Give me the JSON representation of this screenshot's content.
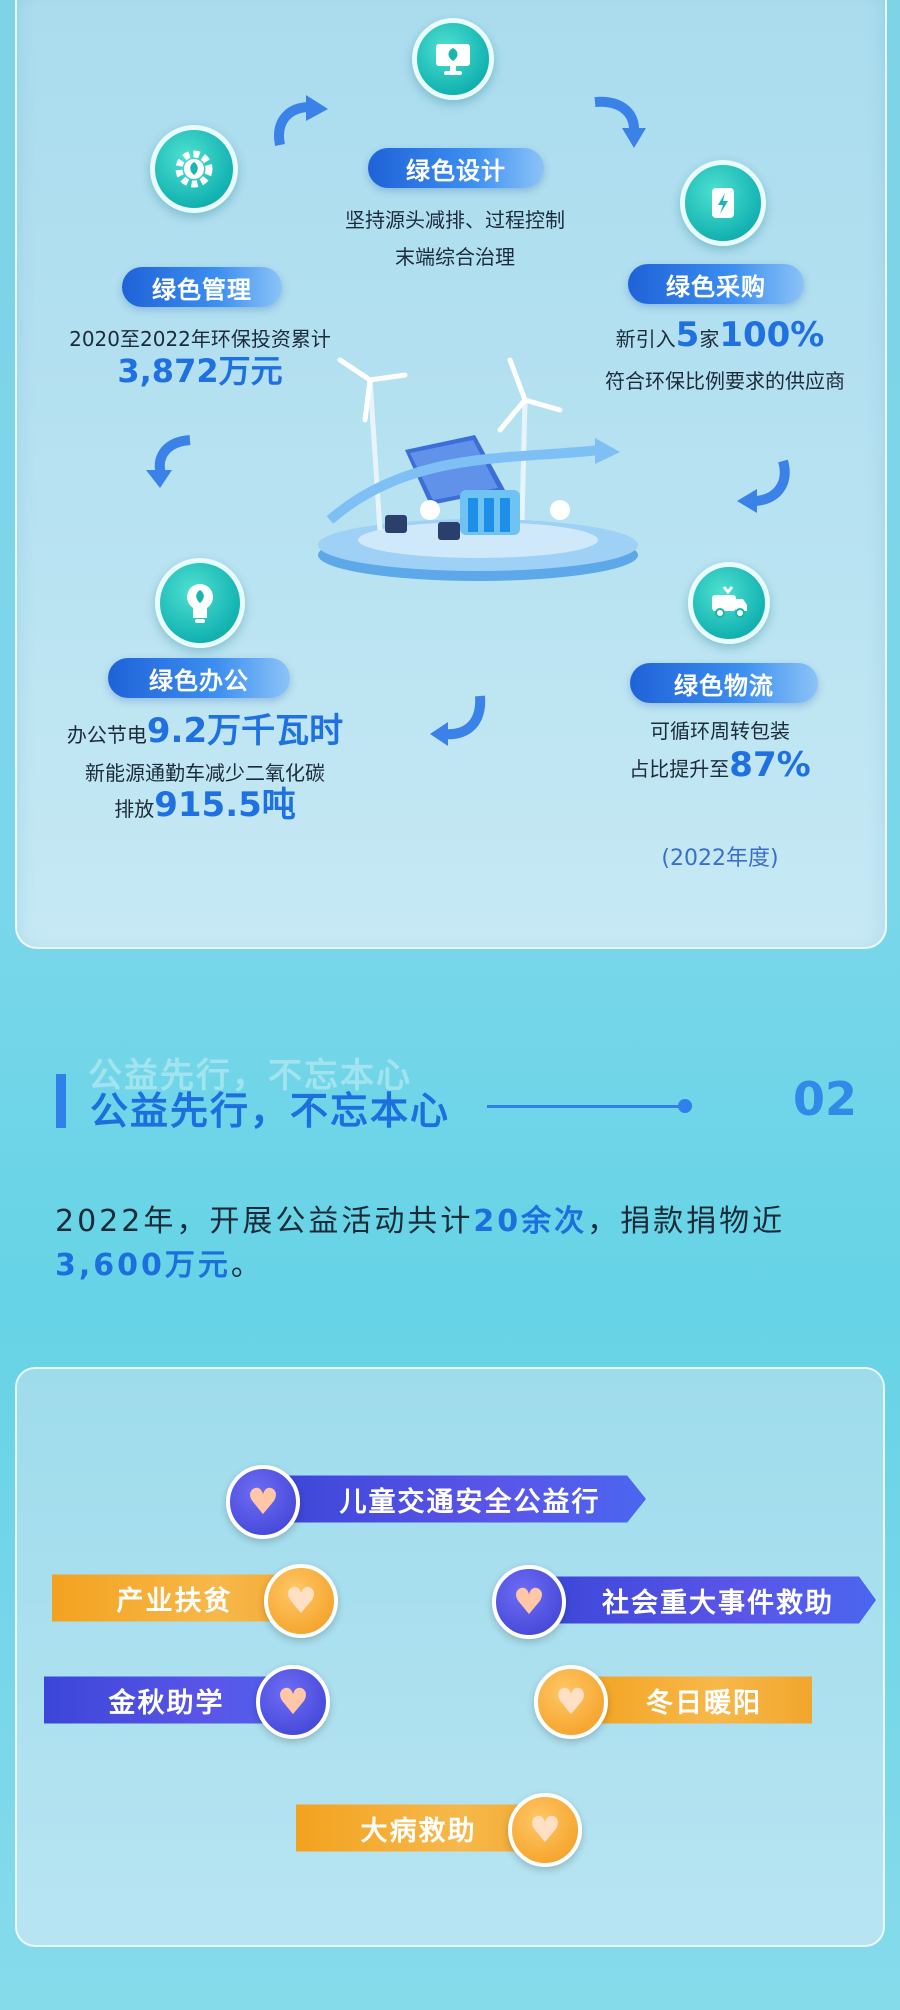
{
  "green": {
    "design": {
      "label": "绿色设计",
      "line1": "坚持源头减排、过程控制",
      "line2": "末端综合治理"
    },
    "management": {
      "label": "绿色管理",
      "line1": "2020至2022年环保投资累计",
      "value": "3,872万元"
    },
    "purchase": {
      "label": "绿色采购",
      "prefix": "新引入",
      "count": "5",
      "unit": "家",
      "percent": "100%",
      "line2": "符合环保比例要求的供应商"
    },
    "office": {
      "label": "绿色办公",
      "prefix": "办公节电",
      "power": "9.2万千瓦时",
      "line2": "新能源通勤车减少二氧化碳",
      "prefix3": "排放",
      "co2": "915.5吨"
    },
    "logistics": {
      "label": "绿色物流",
      "line1": "可循环周转包装",
      "prefix2": "占比提升至",
      "percent": "87%"
    },
    "year_note": "(2022年度)"
  },
  "section": {
    "ghost": "公益先行，不忘本心",
    "title": "公益先行，不忘本心",
    "number": "02",
    "para_a": "2022年，开展公益活动共计",
    "para_b": "20余次",
    "para_c": "，捐款捐物近",
    "para_d": "3,600万元",
    "para_e": "。"
  },
  "charity": [
    {
      "label": "儿童交通安全公益行",
      "color": "blue"
    },
    {
      "label": "产业扶贫",
      "color": "orange"
    },
    {
      "label": "社会重大事件救助",
      "color": "blue"
    },
    {
      "label": "金秋助学",
      "color": "blue"
    },
    {
      "label": "冬日暖阳",
      "color": "orange"
    },
    {
      "label": "大病救助",
      "color": "orange"
    }
  ],
  "colors": {
    "accent_blue": "#1f70e0",
    "teal": "#13b3b2",
    "orange": "#f3a21f",
    "indigo": "#3b46d8"
  }
}
